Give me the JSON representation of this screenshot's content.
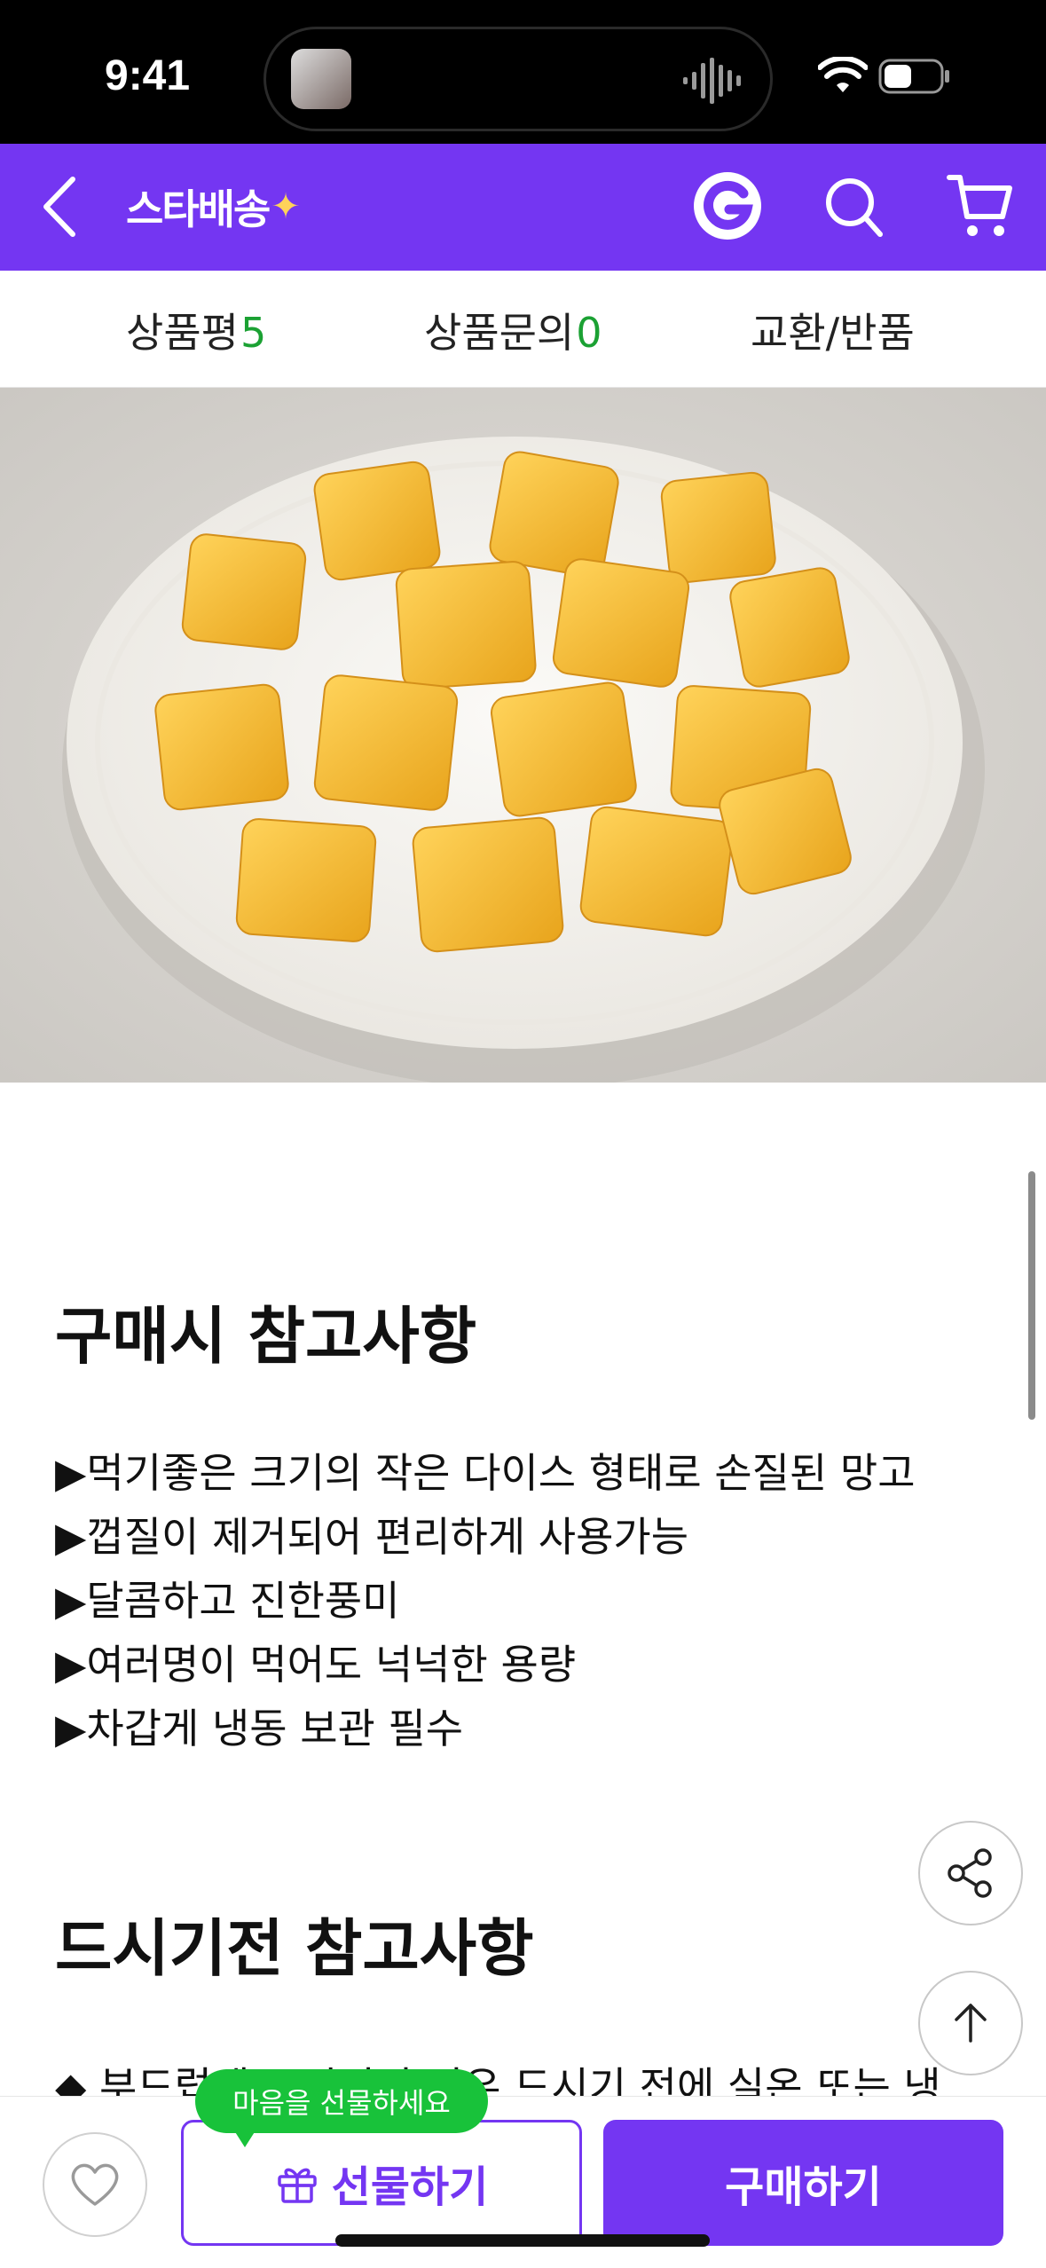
{
  "status": {
    "time": "9:41"
  },
  "header": {
    "logo_text": "스타배송",
    "logo_spark": "✦",
    "icons": [
      "back-icon",
      "g-icon",
      "search-icon",
      "cart-icon"
    ],
    "brand_color": "#7436f2"
  },
  "tabs": [
    {
      "label": "상품평",
      "count": "5"
    },
    {
      "label": "상품문의",
      "count": "0"
    },
    {
      "label": "교환/반품"
    }
  ],
  "sections": {
    "purchase_notes": {
      "title": "구매시 참고사항",
      "items": [
        "▶먹기좋은 크기의 작은 다이스 형태로 손질된 망고",
        "▶껍질이 제거되어 편리하게 사용가능",
        "▶달콤하고 진한풍미",
        "▶여러명이 먹어도 넉넉한 용량",
        "▶차갑게 냉동 보관 필수"
      ]
    },
    "before_eating": {
      "title": "드시기전 참고사항",
      "cutoff_text": "◆ 부드럽게 드시려면 경우 드시기 전에 실온 또는 냉"
    }
  },
  "bottom_bar": {
    "gift_tooltip": "마음을 선물하세요",
    "gift_label": "선물하기",
    "buy_label": "구매하기"
  },
  "colors": {
    "accent": "#7436f2",
    "count_green": "#1ba133",
    "tooltip_green": "#18c23a"
  }
}
